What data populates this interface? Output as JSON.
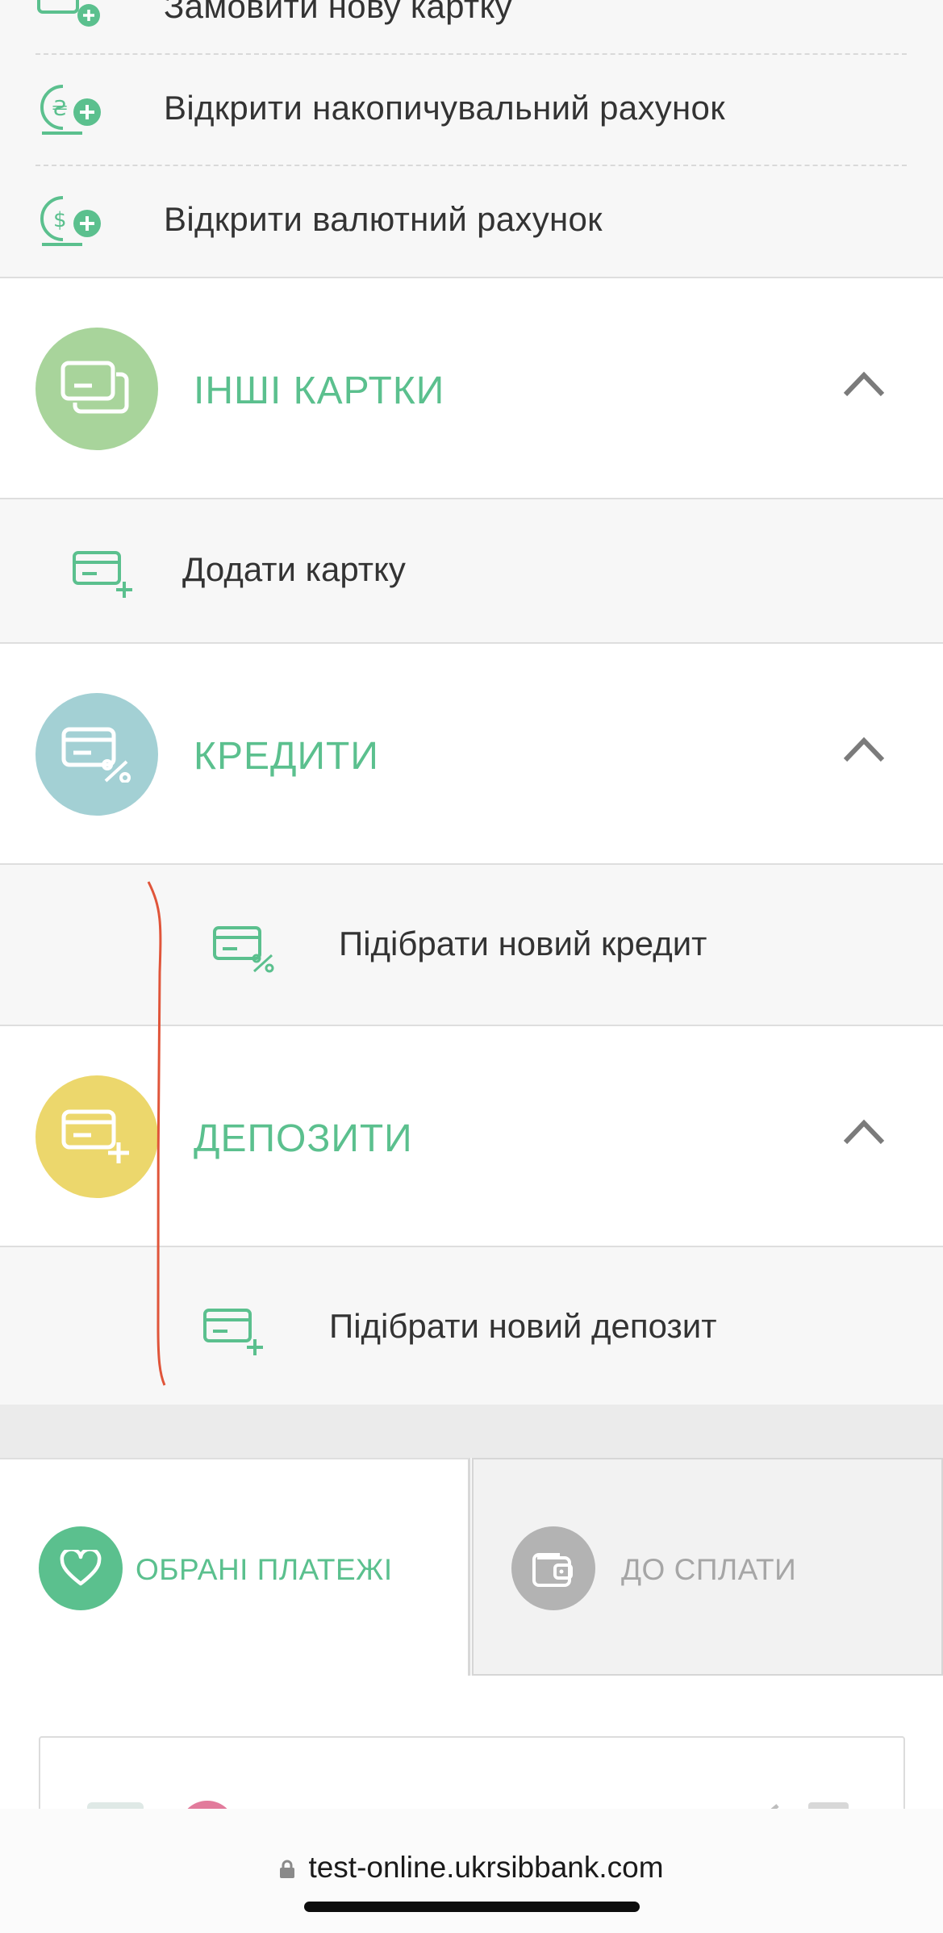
{
  "top_items": [
    {
      "label": "Замовити нову картку",
      "icon": "card-plus-icon"
    },
    {
      "label": "Відкрити накопичувальний рахунок",
      "icon": "hryvnia-coins-plus-icon"
    },
    {
      "label": "Відкрити валютний рахунок",
      "icon": "dollar-coins-plus-icon"
    }
  ],
  "sections": {
    "other_cards": {
      "title": "ІНШІ КАРТКИ",
      "color": "#a8d49b",
      "icon": "cards-icon",
      "item": "Додати картку",
      "item_icon": "card-plus-icon"
    },
    "credits": {
      "title": "КРЕДИТИ",
      "color": "#a3d0d4",
      "icon": "card-percent-icon",
      "item": "Підібрати новий кредит",
      "item_icon": "card-percent-icon"
    },
    "deposits": {
      "title": "ДЕПОЗИТИ",
      "color": "#ecd76c",
      "icon": "card-plus-icon",
      "item": "Підібрати новий депозит",
      "item_icon": "card-plus-icon"
    }
  },
  "tabs": {
    "favorites": {
      "label": "ОБРАНІ ПЛАТЕЖІ",
      "icon": "heart-icon",
      "color": "#5bc08e"
    },
    "due": {
      "label": "ДО СПЛАТИ",
      "icon": "wallet-icon",
      "color": "#b3b3b3"
    }
  },
  "browser": {
    "url": "test-online.ukrsibbank.com"
  },
  "colors": {
    "accent": "#5bc08e",
    "text": "#333333"
  }
}
